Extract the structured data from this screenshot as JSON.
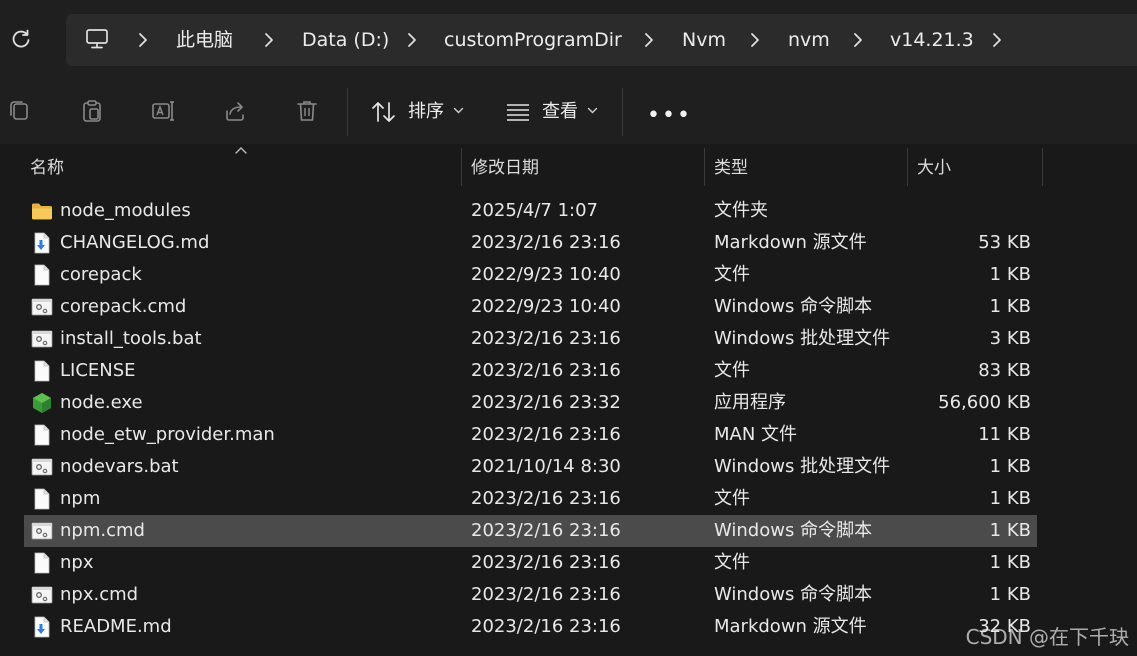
{
  "breadcrumb": {
    "items": [
      "此电脑",
      "Data (D:)",
      "customProgramDir",
      "Nvm",
      "nvm",
      "v14.21.3"
    ]
  },
  "toolbar": {
    "sort_label": "排序",
    "view_label": "查看",
    "more_label": "•••"
  },
  "columns": {
    "name": "名称",
    "date": "修改日期",
    "type": "类型",
    "size": "大小"
  },
  "files": [
    {
      "name": "node_modules",
      "date": "2025/4/7 1:07",
      "type": "文件夹",
      "size": "",
      "icon": "folder-icon"
    },
    {
      "name": "CHANGELOG.md",
      "date": "2023/2/16 23:16",
      "type": "Markdown 源文件",
      "size": "53 KB",
      "icon": "markdown-file-icon"
    },
    {
      "name": "corepack",
      "date": "2022/9/23 10:40",
      "type": "文件",
      "size": "1 KB",
      "icon": "file-icon"
    },
    {
      "name": "corepack.cmd",
      "date": "2022/9/23 10:40",
      "type": "Windows 命令脚本",
      "size": "1 KB",
      "icon": "script-file-icon"
    },
    {
      "name": "install_tools.bat",
      "date": "2023/2/16 23:16",
      "type": "Windows 批处理文件",
      "size": "3 KB",
      "icon": "script-file-icon"
    },
    {
      "name": "LICENSE",
      "date": "2023/2/16 23:16",
      "type": "文件",
      "size": "83 KB",
      "icon": "file-icon"
    },
    {
      "name": "node.exe",
      "date": "2023/2/16 23:32",
      "type": "应用程序",
      "size": "56,600 KB",
      "icon": "node-app-icon"
    },
    {
      "name": "node_etw_provider.man",
      "date": "2023/2/16 23:16",
      "type": "MAN 文件",
      "size": "11 KB",
      "icon": "file-icon"
    },
    {
      "name": "nodevars.bat",
      "date": "2021/10/14 8:30",
      "type": "Windows 批处理文件",
      "size": "1 KB",
      "icon": "script-file-icon"
    },
    {
      "name": "npm",
      "date": "2023/2/16 23:16",
      "type": "文件",
      "size": "1 KB",
      "icon": "file-icon"
    },
    {
      "name": "npm.cmd",
      "date": "2023/2/16 23:16",
      "type": "Windows 命令脚本",
      "size": "1 KB",
      "icon": "script-file-icon",
      "selected": true
    },
    {
      "name": "npx",
      "date": "2023/2/16 23:16",
      "type": "文件",
      "size": "1 KB",
      "icon": "file-icon"
    },
    {
      "name": "npx.cmd",
      "date": "2023/2/16 23:16",
      "type": "Windows 命令脚本",
      "size": "1 KB",
      "icon": "script-file-icon"
    },
    {
      "name": "README.md",
      "date": "2023/2/16 23:16",
      "type": "Markdown 源文件",
      "size": "32 KB",
      "icon": "markdown-file-icon"
    }
  ],
  "watermark": "CSDN @在下千玦",
  "colors": {
    "background": "#191919",
    "selected_row": "#4b4b4b",
    "folder": "#f2c14e",
    "node_green": "#3c9a3c"
  }
}
